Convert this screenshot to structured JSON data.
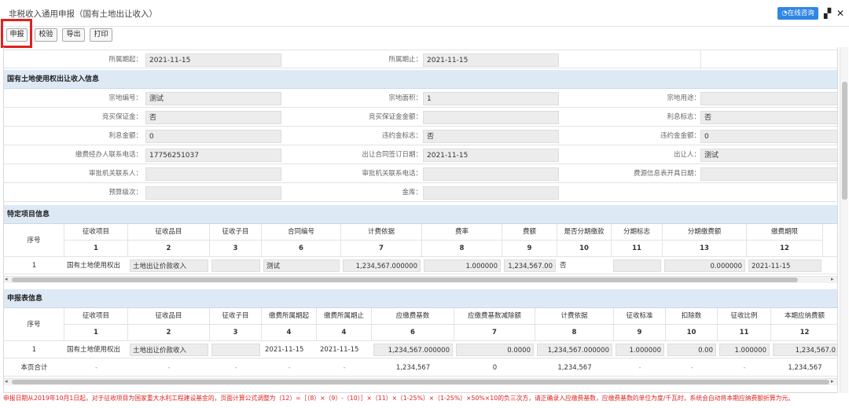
{
  "window": {
    "title": "非税收入通用申报（国有土地出让收入）",
    "consult": "在线咨询"
  },
  "toolbar": {
    "declare": "申报",
    "verify": "校验",
    "export": "导出",
    "print": "打印"
  },
  "period": {
    "start_label": "所属期起：",
    "start": "2021-11-15",
    "end_label": "所属期止：",
    "end": "2021-11-15"
  },
  "land": {
    "title": "国有土地使用权出让收入信息",
    "fields": [
      {
        "label": "宗地编号：",
        "value": "测试"
      },
      {
        "label": "宗地面积：",
        "value": "1"
      },
      {
        "label": "宗地用途：",
        "value": ""
      },
      {
        "label": "竞买保证金：",
        "value": "否"
      },
      {
        "label": "竞买保证金金额：",
        "value": ""
      },
      {
        "label": "利息标志：",
        "value": "否"
      },
      {
        "label": "利息金额：",
        "value": "0"
      },
      {
        "label": "违约金标志：",
        "value": "否"
      },
      {
        "label": "违约金金额：",
        "value": "0"
      },
      {
        "label": "缴费经办人联系电话：",
        "value": "17756251037"
      },
      {
        "label": "出让合同签订日期：",
        "value": "2021-11-15"
      },
      {
        "label": "出让人：",
        "value": "测试"
      },
      {
        "label": "审批机关联系人：",
        "value": ""
      },
      {
        "label": "审批机关联系电话：",
        "value": ""
      },
      {
        "label": "费源信息表开具日期：",
        "value": ""
      },
      {
        "label": "预算级次：",
        "value": ""
      },
      {
        "label": "金库：",
        "value": ""
      }
    ]
  },
  "special": {
    "title": "特定项目信息",
    "headers": [
      "序号",
      "征收项目",
      "征收品目",
      "征收子目",
      "合同编号",
      "计费依据",
      "费率",
      "费额",
      "是否分期缴款",
      "分期标志",
      "分期缴费额",
      "缴费期限"
    ],
    "nums": [
      "1",
      "2",
      "3",
      "6",
      "7",
      "8",
      "9",
      "10",
      "11",
      "13",
      "12"
    ],
    "row": {
      "seq": "1",
      "item": "国有土地使用权出",
      "sub": "土地出让价款收入",
      "subitem": "",
      "contract": "测试",
      "basis": "1,234,567.000000",
      "rate": "1.000000",
      "amount": "1,234,567.00",
      "installment": "否",
      "flag": "",
      "inst_amount": "0.000000",
      "deadline": "2021-11-15"
    }
  },
  "decl": {
    "title": "申报表信息",
    "headers": [
      "序号",
      "征收项目",
      "征收品目",
      "征收子目",
      "缴费所属期起",
      "缴费所属期止",
      "应缴费基数",
      "应缴费基数减除额",
      "计费依据",
      "征收标准",
      "扣除数",
      "征收比例",
      "本期应纳费额"
    ],
    "nums": [
      "1",
      "2",
      "3",
      "4",
      "4",
      "6",
      "7",
      "8",
      "9",
      "10",
      "11",
      "12"
    ],
    "row": {
      "seq": "1",
      "item": "国有土地使用权出",
      "sub": "土地出让价款收入",
      "subitem": "",
      "start": "2021-11-15",
      "end": "2021-11-15",
      "base": "1,234,567.000000",
      "deduct": "0.0000",
      "basis": "1,234,567.000000",
      "standard": "1.000000",
      "less": "0.00",
      "ratio": "1.000000",
      "due": "1,234,567.0"
    },
    "total": {
      "label": "本页合计",
      "dash": "-",
      "base": "1,234,567",
      "deduct": "0",
      "basis": "1,234,567",
      "due": "1,234,567"
    }
  },
  "note": "申报日期从2019年10月1日起，对于征收项目为国家重大水利工程建设基金的，页面计算公式调整为（12）=［（8）×（9）-（10）］×（11）×（1-25%）×（1-25%）×50%×10的负三次方，请正确录入应缴费基数，应缴费基数的单位为度/千瓦时，系统会自动将本期应纳费额折算为元。"
}
